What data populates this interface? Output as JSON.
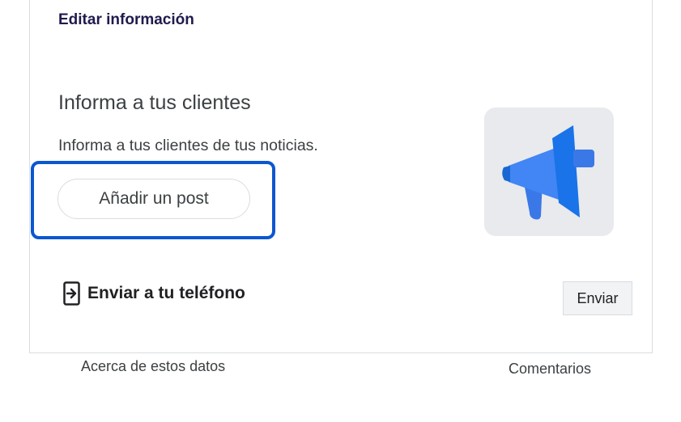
{
  "header": {
    "edit_link": "Editar información"
  },
  "post_card": {
    "title": "Informa a tus clientes",
    "description": "Informa a tus clientes de tus noticias.",
    "add_post_button": "Añadir un post",
    "illustration_icon": "megaphone-icon",
    "accent_color": "#0b57d0",
    "megaphone_color": "#4285f4"
  },
  "send_to_phone": {
    "icon": "send-to-device-icon",
    "title": "Enviar a tu teléfono",
    "button": "Enviar"
  },
  "footer": {
    "about_data": "Acerca de estos datos",
    "feedback": "Comentarios"
  }
}
